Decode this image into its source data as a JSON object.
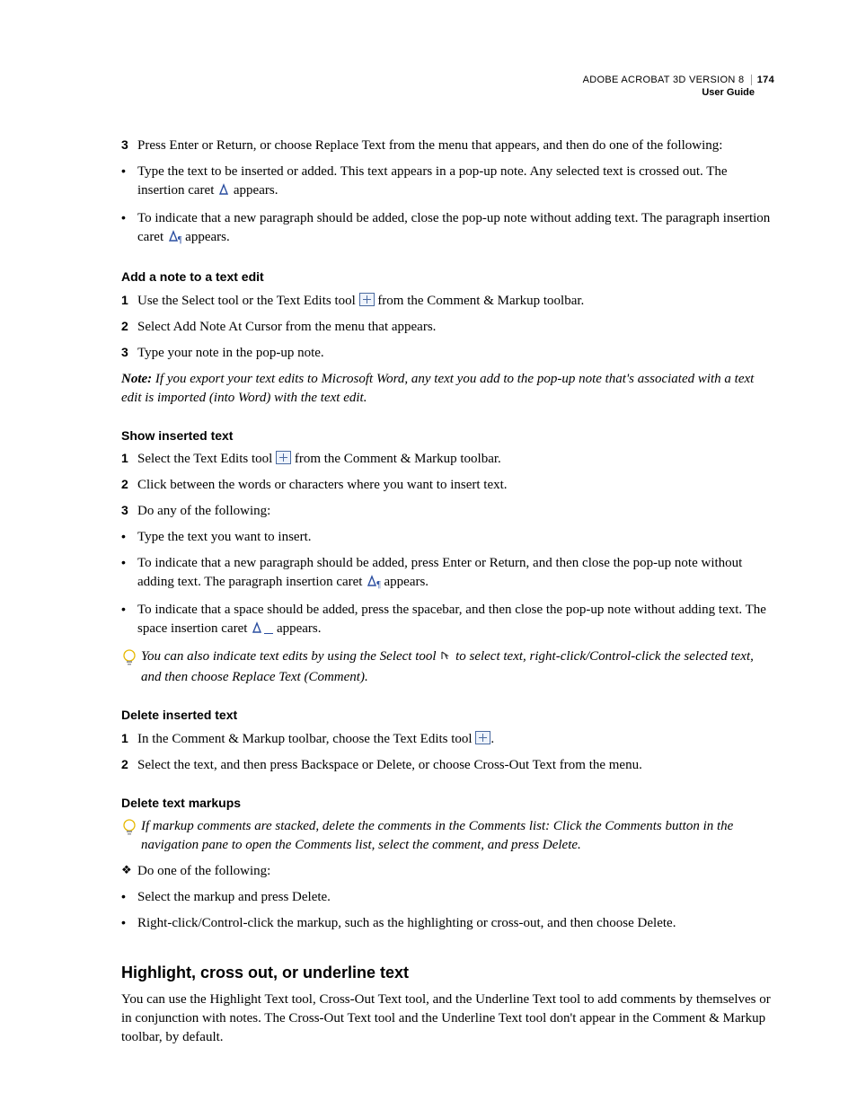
{
  "header": {
    "product": "ADOBE ACROBAT 3D VERSION 8",
    "page_number": "174",
    "subtitle": "User Guide"
  },
  "section_intro": {
    "step3": {
      "num": "3",
      "text": "Press Enter or Return, or choose Replace Text from the menu that appears, and then do one of the following:"
    },
    "bullets": [
      {
        "pre": "Type the text to be inserted or added. This text appears in a pop-up note. Any selected text is crossed out. The insertion caret ",
        "post": " appears."
      },
      {
        "pre": "To indicate that a new paragraph should be added, close the pop-up note without adding text. The paragraph insertion caret ",
        "post": " appears."
      }
    ]
  },
  "add_note": {
    "heading": "Add a note to a text edit",
    "steps": [
      {
        "num": "1",
        "pre": "Use the Select tool or the Text Edits tool ",
        "post": " from the Comment & Markup toolbar."
      },
      {
        "num": "2",
        "text": "Select Add Note At Cursor from the menu that appears."
      },
      {
        "num": "3",
        "text": "Type your note in the pop-up note."
      }
    ],
    "note_label": "Note:",
    "note_text": " If you export your text edits to Microsoft Word, any text you add to the pop-up note that's associated with a text edit is imported (into Word) with the text edit."
  },
  "show_inserted": {
    "heading": "Show inserted text",
    "steps": [
      {
        "num": "1",
        "pre": "Select the Text Edits tool ",
        "post": " from the Comment & Markup toolbar."
      },
      {
        "num": "2",
        "text": "Click between the words or characters where you want to insert text."
      },
      {
        "num": "3",
        "text": "Do any of the following:"
      }
    ],
    "bullets": [
      {
        "text": "Type the text you want to insert."
      },
      {
        "pre": "To indicate that a new paragraph should be added, press Enter or Return, and then close the pop-up note without adding text. The paragraph insertion caret ",
        "post": " appears."
      },
      {
        "pre": "To indicate that a space should be added, press the spacebar, and then close the pop-up note without adding text. The space insertion caret ",
        "post": " appears."
      }
    ],
    "tip_pre": "You can also indicate text edits by using the Select tool ",
    "tip_post": " to select text, right-click/Control-click the selected text, and then choose Replace Text (Comment)."
  },
  "delete_inserted": {
    "heading": "Delete inserted text",
    "steps": [
      {
        "num": "1",
        "pre": "In the Comment & Markup toolbar, choose the Text Edits tool ",
        "post": "."
      },
      {
        "num": "2",
        "text": "Select the text, and then press Backspace or Delete, or choose Cross-Out Text from the menu."
      }
    ]
  },
  "delete_markups": {
    "heading": "Delete text markups",
    "tip": "If markup comments are stacked, delete the comments in the Comments list: Click the Comments button in the navigation pane to open the Comments list, select the comment, and press Delete.",
    "diamond_text": "Do one of the following:",
    "bullets": [
      "Select the markup and press Delete.",
      "Right-click/Control-click the markup, such as the highlighting or cross-out, and then choose Delete."
    ]
  },
  "highlight": {
    "heading": "Highlight, cross out, or underline text",
    "para": "You can use the Highlight Text tool, Cross-Out Text tool, and the Underline Text tool to add comments by themselves or in conjunction with notes. The Cross-Out Text tool and the Underline Text tool don't appear in the Comment & Markup toolbar, by default."
  }
}
